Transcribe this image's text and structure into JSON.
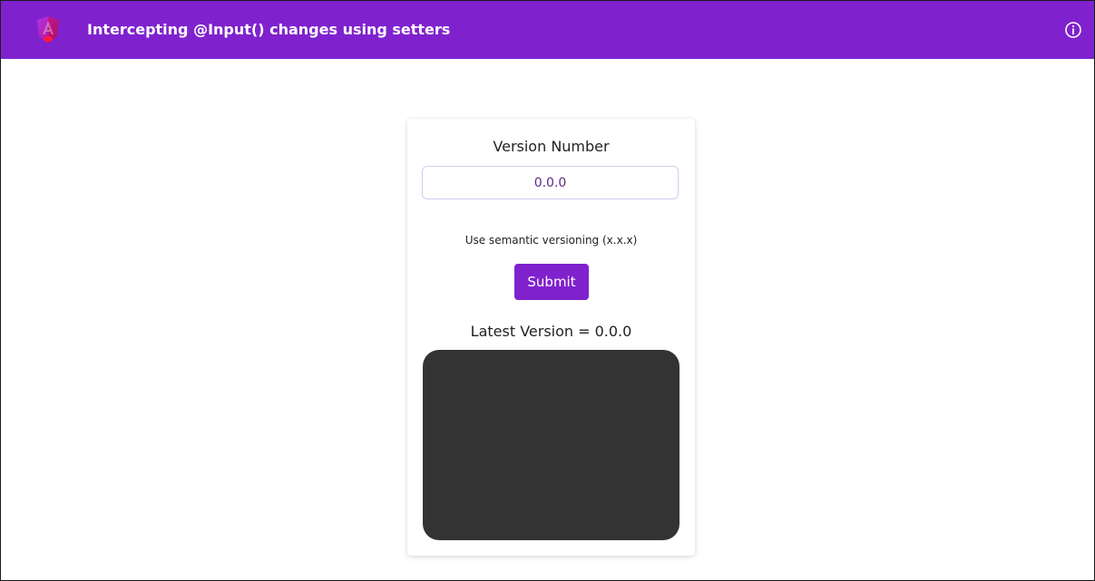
{
  "header": {
    "title": "Intercepting @Input() changes using setters",
    "logo_icon": "angular-logo-icon",
    "info_icon": "info-circle-icon",
    "background_color": "#7f22ce"
  },
  "form": {
    "field_label": "Version Number",
    "version_value": "0.0.0",
    "hint": "Use semantic versioning (x.x.x)",
    "submit_label": "Submit"
  },
  "result": {
    "latest_label": "Latest Version = ",
    "latest_value": "0.0.0",
    "panel_color": "#333333"
  }
}
